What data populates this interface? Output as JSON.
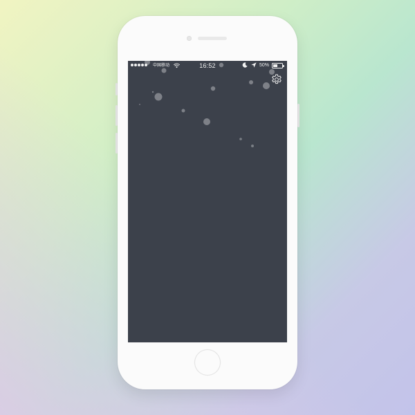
{
  "status_bar": {
    "carrier": "中国移动",
    "time": "16:52",
    "battery_percent_label": "50%",
    "battery_level": 0.5,
    "signal_bars": 5,
    "icons": [
      "signal-dots-icon",
      "wifi-icon",
      "moon-icon",
      "location-arrow-icon",
      "battery-icon"
    ]
  },
  "toolbar": {
    "settings_icon": "gear-icon"
  },
  "colors": {
    "screen_background": "#3c414b",
    "particle": "#8a8d93",
    "status_text": "#f1f1f1",
    "device_body": "#fbfbfb"
  }
}
